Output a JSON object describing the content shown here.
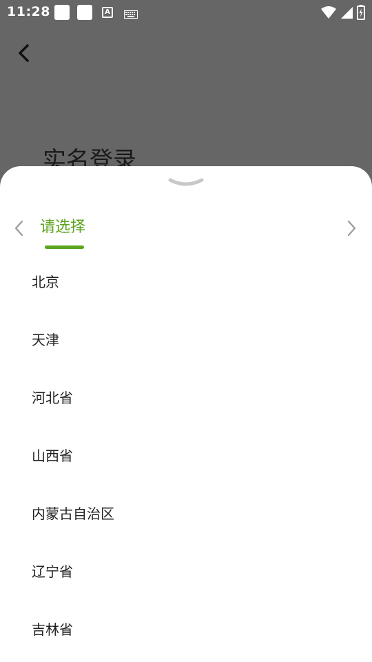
{
  "status_bar": {
    "time": "11:28",
    "notification_badge_letter": "A",
    "icons": [
      "notification-square-icon",
      "notification-square-icon",
      "text-a-icon",
      "keyboard-icon",
      "wifi-icon",
      "cellular-signal-icon",
      "battery-charging-icon"
    ]
  },
  "background_page": {
    "title": "实名登录"
  },
  "sheet": {
    "active_tab_label": "请选择",
    "accent_color": "#5ba41e",
    "regions": [
      "北京",
      "天津",
      "河北省",
      "山西省",
      "内蒙古自治区",
      "辽宁省",
      "吉林省"
    ]
  }
}
